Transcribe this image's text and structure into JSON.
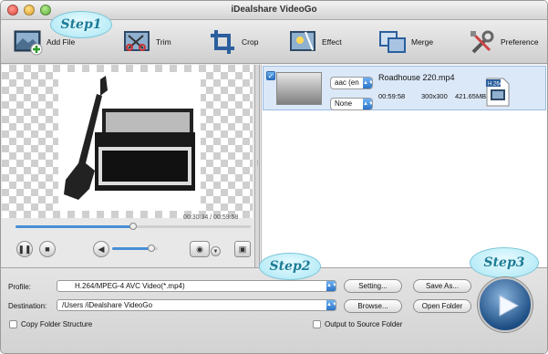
{
  "window": {
    "title": "iDealshare VideoGo"
  },
  "toolbar": {
    "items": [
      {
        "label": "Add File",
        "icon": "add-file-icon"
      },
      {
        "label": "Trim",
        "icon": "trim-icon"
      },
      {
        "label": "Crop",
        "icon": "crop-icon"
      },
      {
        "label": "Effect",
        "icon": "effect-icon"
      },
      {
        "label": "Merge",
        "icon": "merge-icon"
      },
      {
        "label": "Preference",
        "icon": "preference-icon"
      }
    ]
  },
  "callouts": {
    "step1": "Step1",
    "step2": "Step2",
    "step3": "Step3"
  },
  "player": {
    "time": "00:30:34 / 00:59:58",
    "progress": 0.5,
    "volume": 0.85
  },
  "file": {
    "name": "Roadhouse 220.mp4",
    "audio": "aac (en",
    "subtitle": "None",
    "duration": "00:59:58",
    "resolution": "300x300",
    "size": "421.65MB",
    "format_badge": "H.264"
  },
  "bottom": {
    "profile_label": "Profile:",
    "profile_value": "H.264/MPEG-4 AVC Video(*.mp4)",
    "destination_label": "Destination:",
    "destination_value": "/Users /iDealshare VideoGo",
    "setting": "Setting...",
    "save_as": "Save As...",
    "browse": "Browse...",
    "open_folder": "Open Folder",
    "copy_folder": "Copy Folder Structure",
    "output_source": "Output to Source Folder"
  },
  "colors": {
    "accent": "#2a74c8",
    "callout": "#1d7c97"
  }
}
